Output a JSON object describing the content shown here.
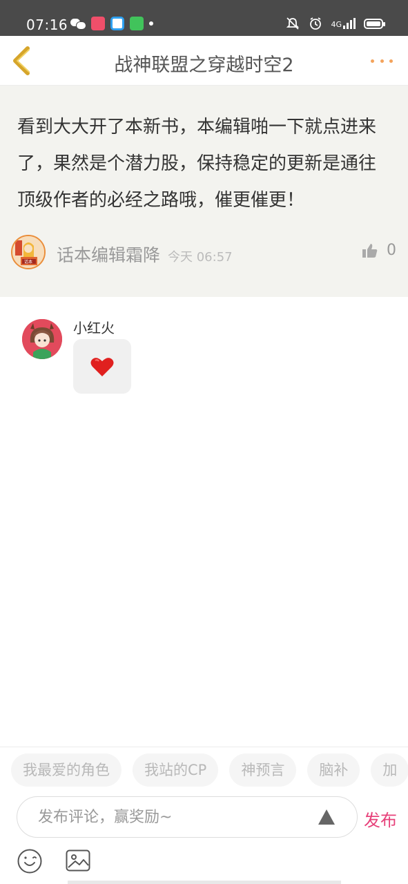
{
  "status_bar": {
    "time": "07:16",
    "network": "4G"
  },
  "header": {
    "title": "战神联盟之穿越时空2"
  },
  "comment": {
    "text": "看到大大开了本新书，本编辑啪一下就点进来了，果然是个潜力股，保持稳定的更新是通往顶级作者的必经之路哦，催更催更！",
    "author": "话本编辑霜降",
    "time": "今天 06:57",
    "likes": "0",
    "author_badge": "话本"
  },
  "reply": {
    "author": "小红火",
    "content_icon": "heart-icon"
  },
  "quick_tags": [
    "我最爱的角色",
    "我站的CP",
    "神预言",
    "脑补",
    "加"
  ],
  "composer": {
    "placeholder": "发布评论，赢奖励~",
    "publish_label": "发布"
  },
  "colors": {
    "accent": "#e7417a",
    "back_arrow": "#d6a52a",
    "more_dots": "#f3a35c",
    "heart": "#e0201f"
  }
}
